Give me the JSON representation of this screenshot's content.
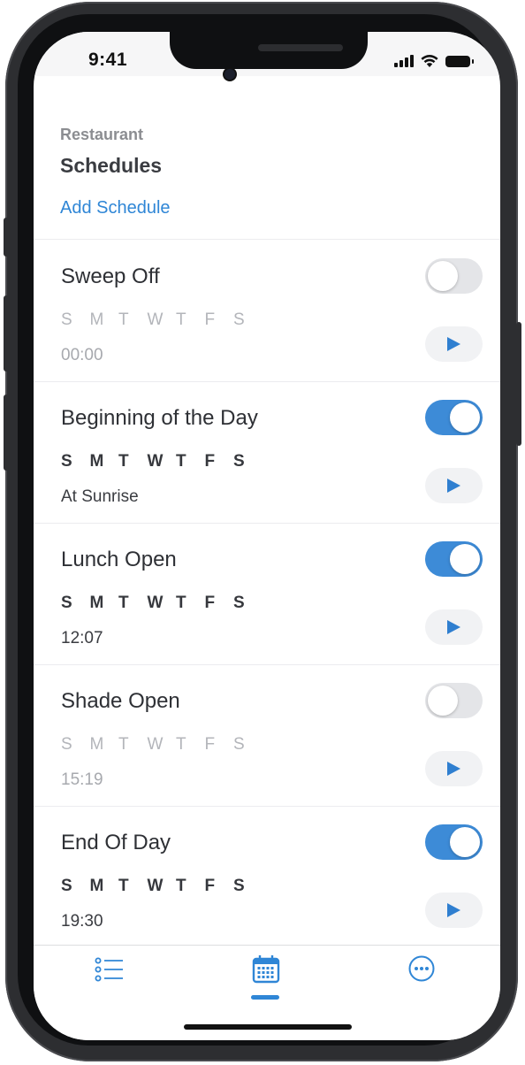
{
  "status_bar": {
    "time": "9:41"
  },
  "header": {
    "subtitle": "Restaurant",
    "title": "Schedules",
    "add_label": "Add Schedule"
  },
  "schedules": [
    {
      "name": "Sweep Off",
      "days": [
        "S",
        "M",
        "T",
        "W",
        "T",
        "F",
        "S"
      ],
      "time": "00:00",
      "enabled": false
    },
    {
      "name": "Beginning of the Day",
      "days": [
        "S",
        "M",
        "T",
        "W",
        "T",
        "F",
        "S"
      ],
      "time": "At Sunrise",
      "enabled": true
    },
    {
      "name": "Lunch Open",
      "days": [
        "S",
        "M",
        "T",
        "W",
        "T",
        "F",
        "S"
      ],
      "time": "12:07",
      "enabled": true
    },
    {
      "name": "Shade Open",
      "days": [
        "S",
        "M",
        "T",
        "W",
        "T",
        "F",
        "S"
      ],
      "time": "15:19",
      "enabled": false
    },
    {
      "name": "End Of Day",
      "days": [
        "S",
        "M",
        "T",
        "W",
        "T",
        "F",
        "S"
      ],
      "time": "19:30",
      "enabled": true
    }
  ],
  "tabbar": {
    "tabs": [
      {
        "icon": "list-icon",
        "active": false
      },
      {
        "icon": "calendar-icon",
        "active": true
      },
      {
        "icon": "more-icon",
        "active": false
      }
    ]
  },
  "colors": {
    "accent": "#2f86d6",
    "toggle_on": "#3d8bd7",
    "toggle_off": "#e4e5e8"
  }
}
